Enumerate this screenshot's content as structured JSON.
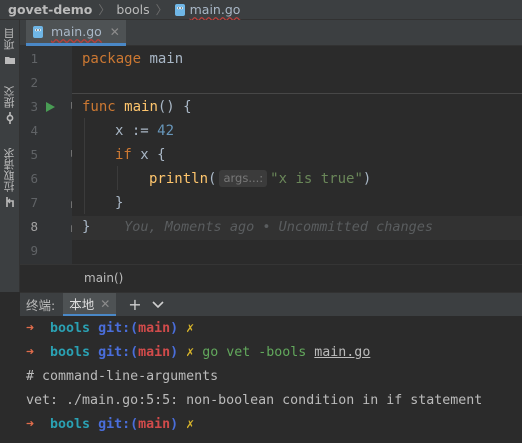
{
  "breadcrumb": {
    "project": "govet-demo",
    "folder": "bools",
    "file": "main.go"
  },
  "sidebar": {
    "tabs": [
      {
        "label": "项目",
        "icon": "folder-icon"
      },
      {
        "label": "提交",
        "icon": "commit-icon"
      },
      {
        "label": "拉取请求",
        "icon": "pull-request-icon"
      }
    ]
  },
  "editor": {
    "tab_label": "main.go",
    "line_numbers": [
      "1",
      "2",
      "3",
      "4",
      "5",
      "6",
      "7",
      "8",
      "9"
    ],
    "current_line": "8",
    "lines": {
      "l1_kw": "package",
      "l1_name": " main",
      "l3_kw": "func",
      "l3_fn": "main",
      "l3_rest": "() {",
      "l4_a": "x := ",
      "l4_num": "42",
      "l5_kw": "if",
      "l5_rest": " x {",
      "l6_fn": "println",
      "l6_open": "(",
      "l6_hint": "args...:",
      "l6_str": "\"x is true\"",
      "l6_close": ")",
      "l7": "}",
      "l8": "}",
      "l8_blame": "You, Moments ago • Uncommitted changes"
    }
  },
  "function_breadcrumb": "main()",
  "terminal": {
    "title": "终端:",
    "tab_label": "本地",
    "add_label": "+",
    "dropdown_label": "⌄",
    "prompt_arrow": "➜",
    "dir": "bools",
    "git": "git:(",
    "branch": "main",
    "git_close": ")",
    "dirty": "✗",
    "cmd_vet": "go vet -bools ",
    "cmd_file": "main.go",
    "output_1": "# command-line-arguments",
    "output_2": "vet: ./main.go:5:5: non-boolean condition in if statement"
  },
  "colors": {
    "accent": "#4a88c7",
    "keyword": "#cc7832",
    "function": "#ffc66d",
    "number": "#6897bb",
    "string": "#6a8759"
  }
}
